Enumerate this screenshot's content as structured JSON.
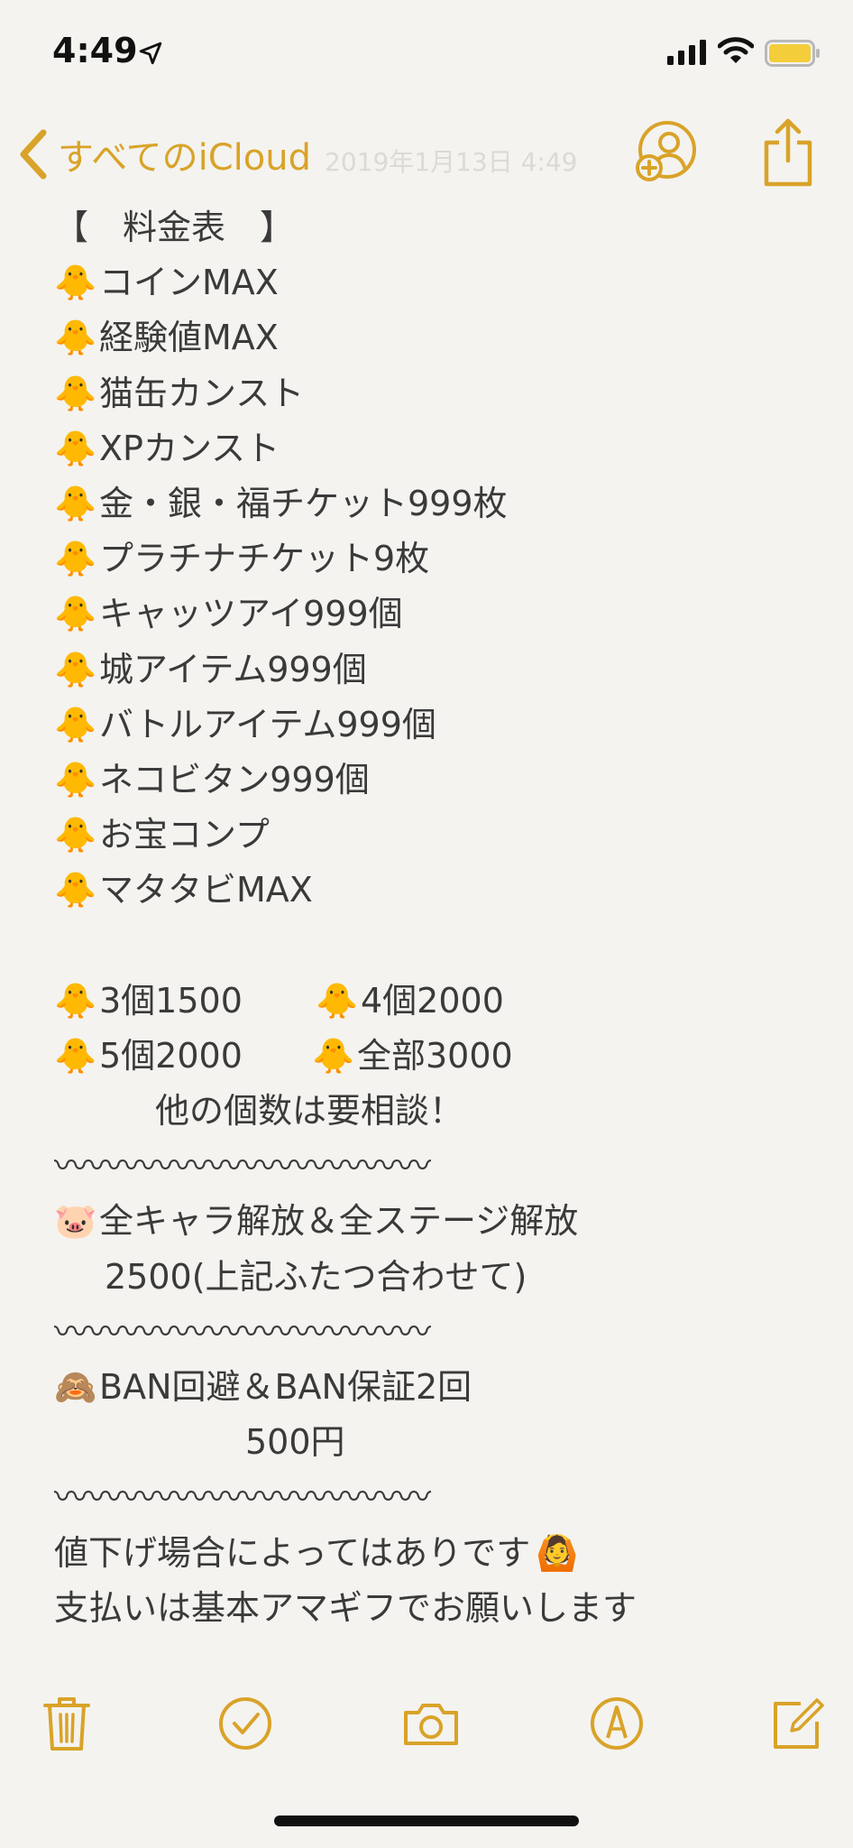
{
  "status_bar": {
    "time": "4:49"
  },
  "nav": {
    "back_label": "すべてのiCloud",
    "faded_date": "2019年1月13日 4:49"
  },
  "note": {
    "title": "【　料金表　】",
    "items": [
      "コインMAX",
      "経験値MAX",
      "猫缶カンスト",
      "XPカンスト",
      "金・銀・福チケット999枚",
      "プラチナチケット9枚",
      "キャッツアイ999個",
      "城アイテム999個",
      "バトルアイテム999個",
      "ネコビタン999個",
      "お宝コンプ",
      "マタタビMAX"
    ],
    "prices": [
      {
        "left": "3個1500",
        "right": "4個2000"
      },
      {
        "left": "5個2000",
        "right": "全部3000"
      }
    ],
    "prices_note": "他の個数は要相談！",
    "wave": "〰〰〰〰〰〰〰〰〰〰〰",
    "unlock_line1": "全キャラ解放＆全ステージ解放",
    "unlock_line2": "2500(上記ふたつ合わせて)",
    "ban_line1": "BAN回避＆BAN保証2回",
    "ban_line2": "500円",
    "footer_line1": "値下げ場合によってはありです",
    "footer_line2": "支払いは基本アマギフでお願いします",
    "emoji_chick": "🐥",
    "emoji_pig": "🐷",
    "emoji_monkey": "🙈",
    "emoji_person": "🙆"
  },
  "colors": {
    "accent": "#d9a329",
    "text": "#3a3a3a",
    "background": "#f4f3ef"
  },
  "icons": {
    "back": "chevron-left-icon",
    "add_person": "add-person-icon",
    "share": "share-icon",
    "trash": "trash-icon",
    "checklist": "checkmark-circle-icon",
    "camera": "camera-icon",
    "markup": "pen-circle-icon",
    "compose": "compose-icon"
  }
}
